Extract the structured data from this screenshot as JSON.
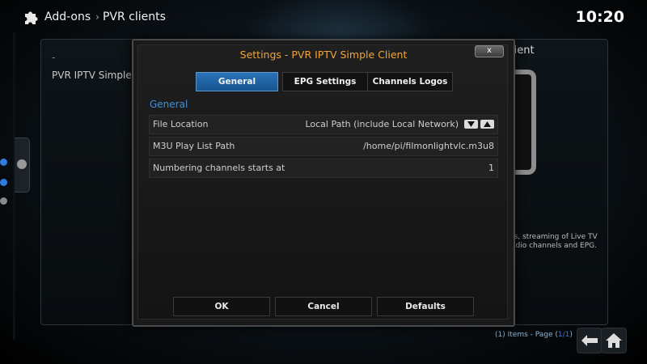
{
  "header": {
    "section": "Add-ons",
    "subsection": "PVR clients",
    "clock": "10:20"
  },
  "background": {
    "list_dash": "-",
    "list_item": "PVR IPTV Simple Client",
    "right_title": "lient",
    "description_lines": [
      "ts, streaming of Live TV",
      "adio channels and EPG."
    ],
    "footer": {
      "prefix": "(1) Items - Page (",
      "page": "1/1",
      "suffix": ")"
    }
  },
  "dialog": {
    "title": "Settings - PVR IPTV Simple Client",
    "close_label": "x",
    "tabs": [
      {
        "label": "General",
        "active": true
      },
      {
        "label": "EPG Settings",
        "active": false
      },
      {
        "label": "Channels Logos",
        "active": false
      }
    ],
    "section_heading": "General",
    "settings": [
      {
        "label": "File Location",
        "value": "Local Path (include Local Network)"
      },
      {
        "label": "M3U Play List Path",
        "value": "/home/pi/filmonlightvlc.m3u8"
      },
      {
        "label": "Numbering channels starts at",
        "value": "1"
      }
    ],
    "buttons": {
      "ok": "OK",
      "cancel": "Cancel",
      "defaults": "Defaults"
    }
  },
  "colors": {
    "accent_title": "#f0a53a",
    "tab_active": "#1e64a6",
    "section_heading": "#3f8fdb",
    "side_dots": [
      "#2f7de0",
      "#2f7de0",
      "#888888"
    ]
  },
  "icons": {
    "header": "puzzle-piece-icon",
    "spinner_down": "arrow-down-icon",
    "spinner_up": "arrow-up-icon",
    "footer_back": "back-arrow-icon",
    "footer_home": "home-icon"
  }
}
